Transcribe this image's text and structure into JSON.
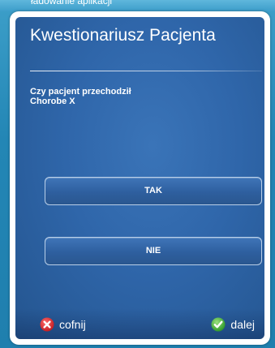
{
  "app": {
    "loading_label": "ładowanie aplikacji"
  },
  "form": {
    "title": "Kwestionariusz Pacjenta",
    "question": "Czy pacjent przechodził\nChorobe X",
    "answers": {
      "yes_label": "TAK",
      "no_label": "NIE"
    }
  },
  "navigation": {
    "back_label": "cofnij",
    "back_icon": "red-x-circle-icon",
    "next_label": "dalej",
    "next_icon": "green-check-circle-icon"
  },
  "colors": {
    "background": "#2386b5",
    "panel": "#2f66aa",
    "frame": "#ffffff",
    "back_icon": "#d6262b",
    "next_icon": "#4cb83a"
  }
}
